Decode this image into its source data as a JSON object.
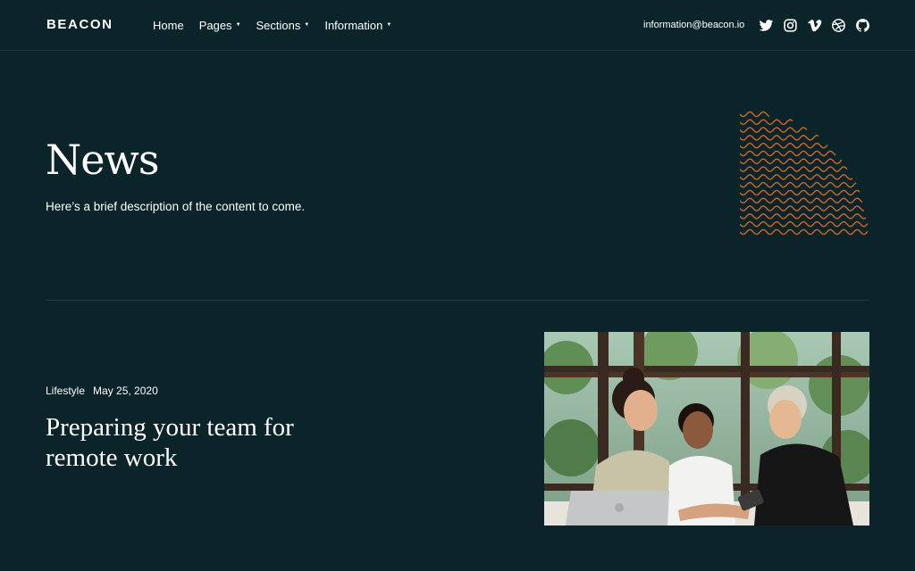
{
  "brand": {
    "name": "BEACON"
  },
  "nav": {
    "items": [
      {
        "label": "Home",
        "has_dropdown": false
      },
      {
        "label": "Pages",
        "has_dropdown": true
      },
      {
        "label": "Sections",
        "has_dropdown": true
      },
      {
        "label": "Information",
        "has_dropdown": true
      }
    ],
    "dropdown_icon": "caret-down-icon",
    "email": "information@beacon.io",
    "socials": [
      "twitter-icon",
      "instagram-icon",
      "vimeo-icon",
      "dribbble-icon",
      "github-icon"
    ]
  },
  "hero": {
    "title": "News",
    "description": "Here’s a brief description of the content to come.",
    "decoration": "wave-pattern-quarter-circle"
  },
  "post": {
    "category": "Lifestyle",
    "date": "May 25, 2020",
    "title": "Preparing your team for remote work",
    "image": "three-women-looking-at-phone-photo"
  },
  "colors": {
    "background": "#0b2429",
    "text": "#ffffff",
    "accent": "#c96a2a",
    "divider": "#1f3c41"
  }
}
